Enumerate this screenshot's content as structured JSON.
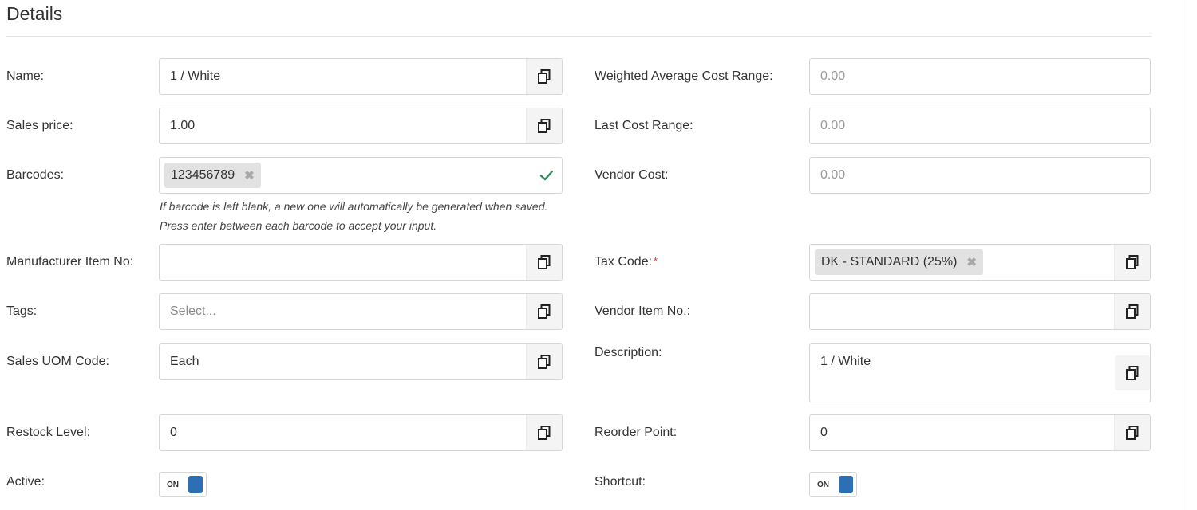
{
  "section": {
    "title": "Details"
  },
  "left": {
    "name": {
      "label": "Name:",
      "value": "1 / White"
    },
    "sales_price": {
      "label": "Sales price:",
      "value": "1.00"
    },
    "barcodes": {
      "label": "Barcodes:",
      "chip": "123456789",
      "remove_glyph": "✖",
      "help": "If barcode is left blank, a new one will automatically be generated when saved. Press enter between each barcode to accept your input."
    },
    "manufacturer_item_no": {
      "label": "Manufacturer Item No:",
      "value": ""
    },
    "tags": {
      "label": "Tags:",
      "placeholder": "Select..."
    },
    "sales_uom_code": {
      "label": "Sales UOM Code:",
      "value": "Each"
    },
    "restock_level": {
      "label": "Restock Level:",
      "value": "0"
    },
    "active": {
      "label": "Active:",
      "toggle_text": "ON"
    }
  },
  "right": {
    "weighted_average_cost_range": {
      "label": "Weighted Average Cost Range:",
      "value": "0.00"
    },
    "last_cost_range": {
      "label": "Last Cost Range:",
      "value": "0.00"
    },
    "vendor_cost": {
      "label": "Vendor Cost:",
      "value": "0.00"
    },
    "tax_code": {
      "label": "Tax Code:",
      "required_mark": "*",
      "chip": "DK - STANDARD (25%)",
      "remove_glyph": "✖"
    },
    "vendor_item_no": {
      "label": "Vendor Item No.:",
      "value": ""
    },
    "description": {
      "label": "Description:",
      "value": "1 / White"
    },
    "reorder_point": {
      "label": "Reorder Point:",
      "value": "0"
    },
    "shortcut": {
      "label": "Shortcut:",
      "toggle_text": "ON"
    }
  },
  "icons": {
    "copy": "copy-icon",
    "check": "check-icon",
    "remove": "remove-chip-icon"
  },
  "colors": {
    "toggle_on": "#2d6fb4",
    "check": "#2e8b57",
    "required": "#d0302b",
    "chip_bg": "#e2e2e2"
  }
}
